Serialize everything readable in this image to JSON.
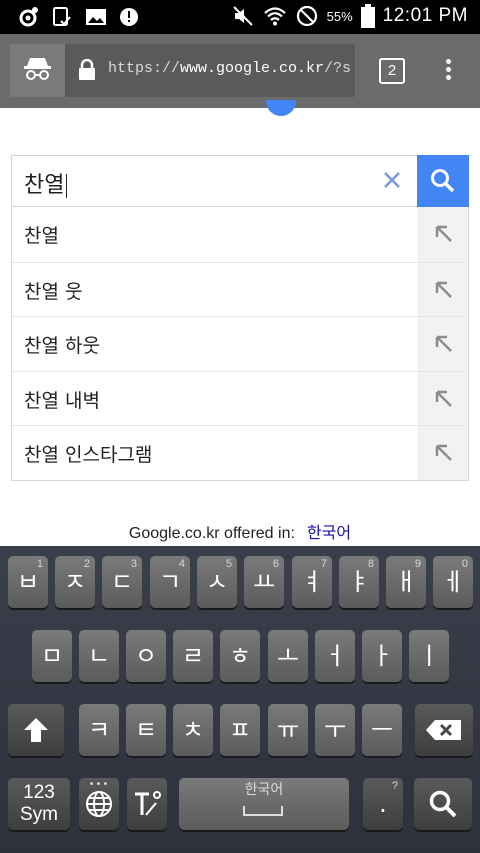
{
  "status_bar": {
    "battery": "55%",
    "time": "12:01 PM"
  },
  "browser": {
    "url_scheme": "https://",
    "url_host": "www.google.co.kr",
    "url_rest": "/?sc",
    "tab_count": "2"
  },
  "search": {
    "query": "찬열",
    "suggestions": [
      "찬열",
      "찬열 웃",
      "찬열 하웃",
      "찬열 내벽",
      "찬열 인스타그램"
    ]
  },
  "offered": {
    "text": "Google.co.kr offered in:",
    "language": "한국어"
  },
  "keyboard": {
    "row1": [
      {
        "k": "ㅂ",
        "n": "1"
      },
      {
        "k": "ㅈ",
        "n": "2"
      },
      {
        "k": "ㄷ",
        "n": "3"
      },
      {
        "k": "ㄱ",
        "n": "4"
      },
      {
        "k": "ㅅ",
        "n": "5"
      },
      {
        "k": "ㅛ",
        "n": "6"
      },
      {
        "k": "ㅕ",
        "n": "7"
      },
      {
        "k": "ㅑ",
        "n": "8"
      },
      {
        "k": "ㅐ",
        "n": "9"
      },
      {
        "k": "ㅔ",
        "n": "0"
      }
    ],
    "row2": [
      "ㅁ",
      "ㄴ",
      "ㅇ",
      "ㄹ",
      "ㅎ",
      "ㅗ",
      "ㅓ",
      "ㅏ",
      "ㅣ"
    ],
    "row3": [
      "ㅋ",
      "ㅌ",
      "ㅊ",
      "ㅍ",
      "ㅠ",
      "ㅜ",
      "ㅡ"
    ],
    "sym_label_1": "123",
    "sym_label_2": "Sym",
    "space_label": "한국어",
    "period": ".",
    "period_sub": "?"
  }
}
